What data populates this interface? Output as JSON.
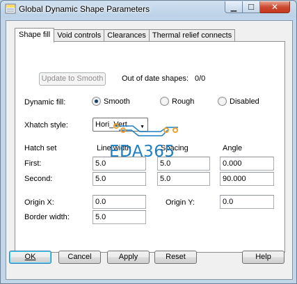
{
  "window": {
    "title": "Global Dynamic Shape Parameters"
  },
  "caption_buttons": {
    "minimize": "▁",
    "maximize": "☐",
    "close": "✕"
  },
  "tabs": [
    {
      "label": "Shape fill",
      "active": true
    },
    {
      "label": "Void controls",
      "active": false
    },
    {
      "label": "Clearances",
      "active": false
    },
    {
      "label": "Thermal relief connects",
      "active": false
    }
  ],
  "shape_fill": {
    "update_button": "Update to Smooth",
    "out_of_date_label": "Out of date shapes:",
    "out_of_date_value": "0/0",
    "dynamic_fill_label": "Dynamic fill:",
    "fill_options": [
      {
        "label": "Smooth",
        "selected": true
      },
      {
        "label": "Rough",
        "selected": false
      },
      {
        "label": "Disabled",
        "selected": false
      }
    ],
    "xhatch_label": "Xhatch style:",
    "xhatch_value": "Hori_Vert",
    "hatch_set_label": "Hatch set",
    "columns": {
      "line_width": "Line width",
      "spacing": "Spacing",
      "angle": "Angle"
    },
    "first": {
      "label": "First:",
      "line_width": "5.0",
      "spacing": "5.0",
      "angle": "0.000"
    },
    "second": {
      "label": "Second:",
      "line_width": "5.0",
      "spacing": "5.0",
      "angle": "90.000"
    },
    "origin_x": {
      "label": "Origin X:",
      "value": "0.0"
    },
    "origin_y": {
      "label": "Origin Y:",
      "value": "0.0"
    },
    "border_width": {
      "label": "Border width:",
      "value": "5.0"
    }
  },
  "footer_buttons": {
    "ok": "OK",
    "cancel": "Cancel",
    "apply": "Apply",
    "reset": "Reset",
    "help": "Help"
  },
  "watermark": {
    "text": "EDA365"
  },
  "colors": {
    "accent": "#3c7fb1",
    "watermark": "#1d7fc2",
    "watermark_dots": "#f0a030"
  }
}
